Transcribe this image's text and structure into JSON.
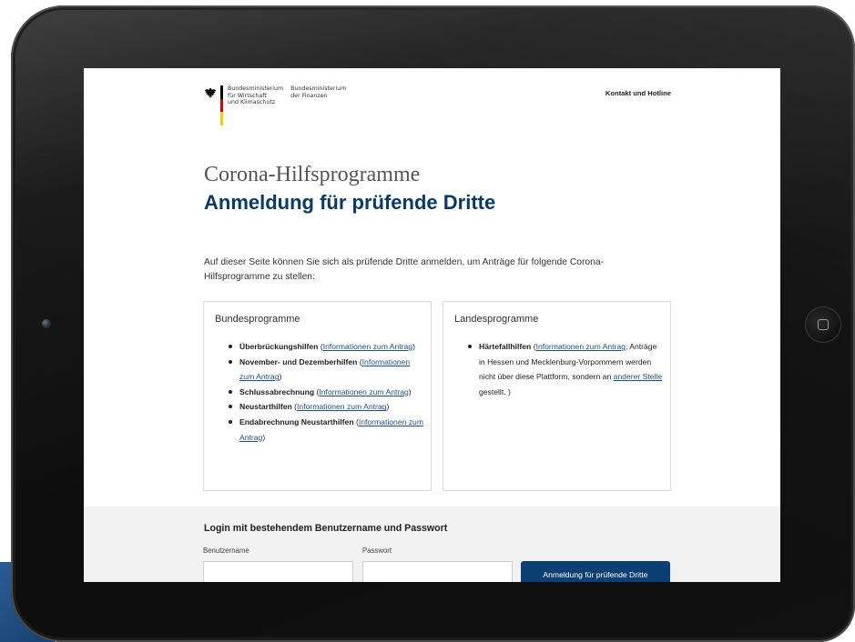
{
  "colors": {
    "brand_blue": "#0a3a67",
    "link_blue": "#1e4f8a",
    "button_blue": "#0c3f73",
    "flag_black": "#000000",
    "flag_red": "#dd0000",
    "flag_gold": "#ffce00"
  },
  "header": {
    "ministry_1": "Bundesministerium\nfür Wirtschaft\nund Klimaschutz",
    "ministry_2": "Bundesministerium\nder Finanzen",
    "contact_link": "Kontakt und Hotline",
    "logo_icon": "federal-eagle-icon"
  },
  "page": {
    "title": "Corona-Hilfsprogramme",
    "subtitle": "Anmeldung für prüfende Dritte",
    "intro": "Auf dieser Seite können Sie sich als prüfende Dritte anmelden, um Anträge für folgende Corona-Hilfsprogramme zu stellen:"
  },
  "bund": {
    "title": "Bundesprogramme",
    "items": [
      {
        "name": "Überbrückungshilfen",
        "pre": " (",
        "link": "Informationen zum Antrag",
        "post": ")"
      },
      {
        "name": "November- und Dezemberhilfen",
        "pre": " (",
        "link": "Informationen zum Antrag",
        "post": ")"
      },
      {
        "name": "Schlussabrechnung",
        "pre": " (",
        "link": "Informationen zum Antrag",
        "post": ")"
      },
      {
        "name": "Neustarthilfen",
        "pre": " (",
        "link": "Informationen zum Antrag",
        "post": ")"
      },
      {
        "name": "Endabrechnung Neustarthilfen",
        "pre": " (",
        "link": "Informationen zum Antrag",
        "post": ")"
      }
    ]
  },
  "land": {
    "title": "Landesprogramme",
    "items": [
      {
        "name": "Härtefallhilfen",
        "pre": " (",
        "link": "Informationen zum Antrag",
        "mid": "; Anträge in Hessen und Mecklenburg-Vorpommern werden nicht über diese Plattform, sondern an ",
        "link2": "anderer Stelle",
        "post": " gestellt. )"
      }
    ]
  },
  "login": {
    "heading": "Login mit bestehendem Benutzername und Passwort",
    "username_label": "Benutzername",
    "username_value": "",
    "password_label": "Passwort",
    "password_value": "",
    "submit_label": "Anmeldung für prüfende Dritte"
  },
  "device": {
    "home_button_icon": "home-button-icon",
    "camera_icon": "front-camera-icon"
  }
}
